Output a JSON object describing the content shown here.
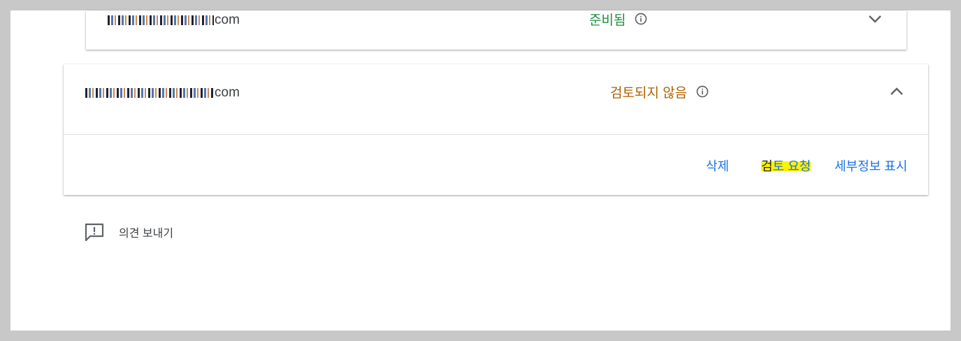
{
  "items": [
    {
      "domain_suffix": "com",
      "status": "준비됨",
      "status_color": "#1e8e3e",
      "expanded": false
    },
    {
      "domain_suffix": "com",
      "status": "검토되지 않음",
      "status_color": "#b06000",
      "expanded": true,
      "actions": {
        "delete": "삭제",
        "request_review_first": "검",
        "request_review_rest": "토 요청",
        "show_details": "세부정보 표시"
      }
    }
  ],
  "feedback": {
    "label": "의견 보내기"
  },
  "colors": {
    "accent": "#1a73e8",
    "highlight": "#fff200"
  },
  "icons": [
    "info-icon",
    "chevron-down-icon",
    "chevron-up-icon",
    "feedback-icon"
  ]
}
